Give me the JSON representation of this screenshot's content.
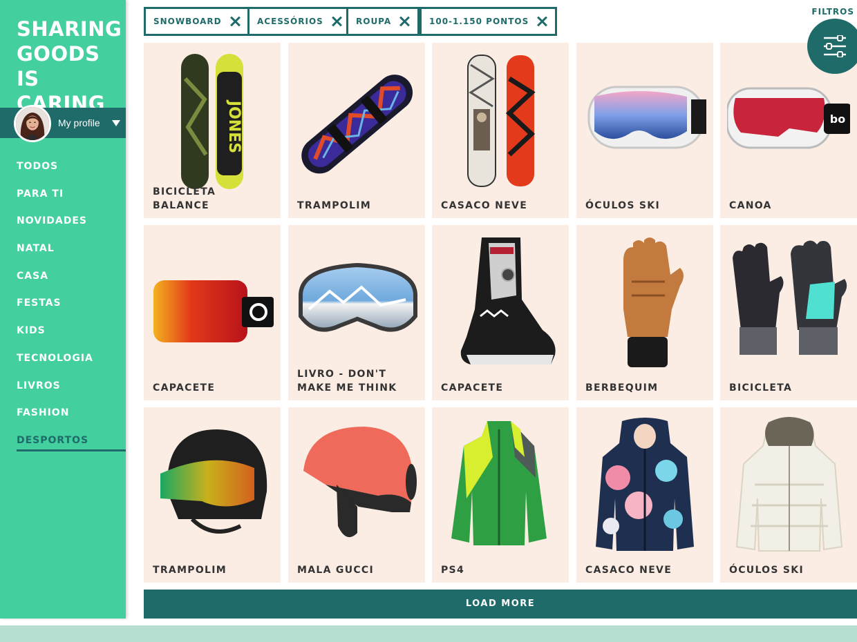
{
  "brand": {
    "line1": "SHARING",
    "line2": "GOODS",
    "line3": "IS CARING"
  },
  "profile": {
    "name": "My profile"
  },
  "nav": {
    "items": [
      "TODOS",
      "PARA TI",
      "NOVIDADES",
      "NATAL",
      "CASA",
      "FESTAS",
      "KIDS",
      "TECNOLOGIA",
      "LIVROS",
      "FASHION",
      "DESPORTOS"
    ],
    "active": "DESPORTOS"
  },
  "filters": {
    "label": "FILTROS",
    "chips": [
      "SNOWBOARD",
      "ACESSÓRIOS",
      "ROUPA",
      "100-1.150 PONTOS"
    ]
  },
  "products": [
    {
      "label": "BICICLETA BALANCE",
      "icon": "snowboard-icon"
    },
    {
      "label": "TRAMPOLIM",
      "icon": "snowboard-icon"
    },
    {
      "label": "CASACO NEVE",
      "icon": "snowboard-icon"
    },
    {
      "label": "ÓCULOS SKI",
      "icon": "goggles-icon"
    },
    {
      "label": "CANOA",
      "icon": "goggles-icon"
    },
    {
      "label": "CAPACETE",
      "icon": "goggles-icon"
    },
    {
      "label": "LIVRO - DON'T MAKE ME THINK",
      "icon": "goggles-icon"
    },
    {
      "label": "CAPACETE",
      "icon": "boot-icon"
    },
    {
      "label": "BERBEQUIM",
      "icon": "glove-icon"
    },
    {
      "label": "BICICLETA",
      "icon": "glove-icon"
    },
    {
      "label": "TRAMPOLIM",
      "icon": "helmet-icon"
    },
    {
      "label": "MALA GUCCI",
      "icon": "helmet-icon"
    },
    {
      "label": "PS4",
      "icon": "jacket-icon"
    },
    {
      "label": "CASACO NEVE",
      "icon": "jacket-icon"
    },
    {
      "label": "ÓCULOS SKI",
      "icon": "jacket-icon"
    }
  ],
  "load_more": "LOAD MORE",
  "colors": {
    "primary": "#1e6b69",
    "sidebar": "#43cf9e",
    "card": "#fbece4",
    "footer": "#b7dfd1"
  }
}
